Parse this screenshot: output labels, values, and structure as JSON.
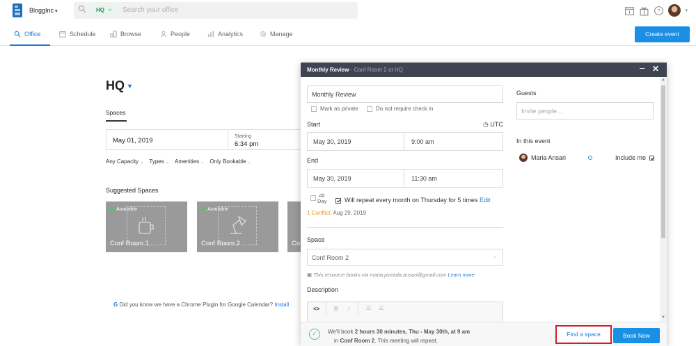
{
  "topbar": {
    "org": "BloggInc",
    "search_chip": "HQ",
    "search_placeholder": "Search your office",
    "icons": [
      "calendar-icon",
      "gift-icon",
      "help-icon",
      "avatar"
    ]
  },
  "nav": {
    "items": [
      "Office",
      "Schedule",
      "Browse",
      "People",
      "Analytics",
      "Manage"
    ],
    "active": "Office",
    "create_button": "Create event"
  },
  "page": {
    "title": "HQ",
    "tab": "Spaces",
    "date": "May 01, 2019",
    "starting_label": "Starting",
    "starting_time": "6:34 pm",
    "filters": [
      "Any Capacity",
      "Types",
      "Amenities",
      "Only Bookable"
    ],
    "suggested_title": "Suggested Spaces",
    "cards": [
      {
        "status": "Available",
        "name": "Conf Room 1"
      },
      {
        "status": "Available",
        "name": "Conf Room 2"
      },
      {
        "status": "",
        "name": "Co"
      }
    ],
    "plugin_text": "Did you know we have a Chrome Plugin for Google Calendar?",
    "plugin_link": "Install"
  },
  "modal": {
    "title": "Monthly Review",
    "subtitle": "- Conf Room 2 at  HQ",
    "event_name": "Monthly Review",
    "mark_private": "Mark as private",
    "no_checkin": "Do not require check in",
    "start_label": "Start",
    "timezone": "UTC",
    "start_date": "May 30, 2019",
    "start_time": "9:00 am",
    "end_label": "End",
    "end_date": "May 30, 2019",
    "end_time": "11:30 am",
    "all_day_1": "All",
    "all_day_2": "Day",
    "repeat_text": "Will repeat every month on Thursday for 5 times",
    "repeat_edit": "Edit",
    "conflict_label": "1 Conflict:",
    "conflict_date": "Aug 29, 2019",
    "space_label": "Space",
    "space_value": "Conf Room 2",
    "resource_note": "This resource books via maria.pirzada.ansari@gmail.com",
    "learn_more": "Learn more",
    "description_label": "Description",
    "guests_label": "Guests",
    "guests_placeholder": "Invite people...",
    "in_event_label": "In this event",
    "attendee": "Maria Ansari",
    "include_me": "Include me",
    "footer_line1_pre": "We'll book",
    "footer_line1_bold": "2 hours 30 minutes, Thu - May 30th, at 9 am",
    "footer_line2_pre": "in",
    "footer_line2_bold": "Conf Room 2",
    "footer_line2_post": ". This meeting will repeat.",
    "find_space": "Find a space",
    "book_now": "Book Now"
  },
  "colors": {
    "accent": "#1a8fe3",
    "header_dark": "#3e4452",
    "available_green": "#3ecf5e",
    "conflict_orange": "#e8941a",
    "highlight_red": "#d0202a"
  }
}
